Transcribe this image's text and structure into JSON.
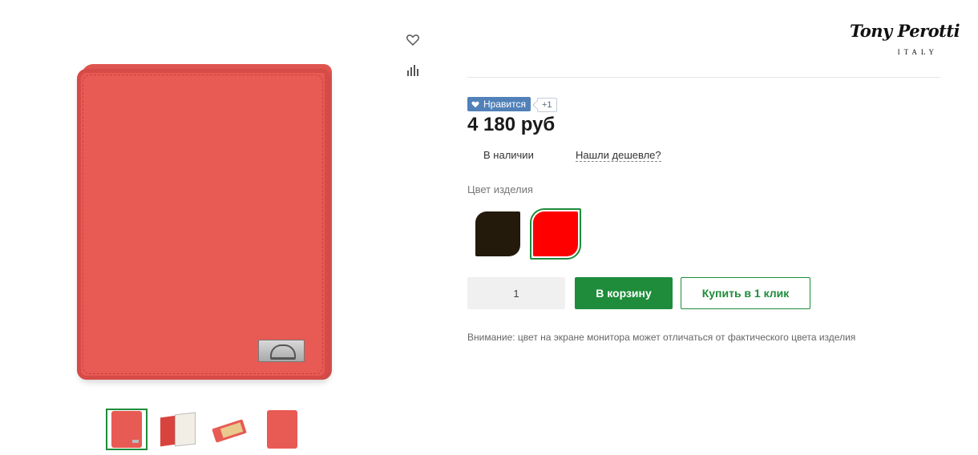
{
  "product": {
    "price": "4 180 руб",
    "stock_status": "В наличии",
    "cheaper_link": "Нашли дешевле?",
    "color_label": "Цвет изделия",
    "colors": [
      {
        "name": "dark-brown",
        "hex": "#231a0b",
        "selected": false
      },
      {
        "name": "red",
        "hex": "#ff0000",
        "selected": true
      }
    ],
    "quantity": "1",
    "notice": "Внимание: цвет на экране мониторa может отличаться от фактического цвета изделия"
  },
  "like_widget": {
    "label": "Нравится",
    "count": "+1",
    "icon": "heart-icon",
    "color": "#5181b8"
  },
  "actions": {
    "add_to_cart": "В корзину",
    "buy_one_click": "Купить в 1 клик"
  },
  "brand": {
    "logo_text": "Tony Perotti",
    "logo_subtext": "ITALY"
  },
  "gallery": {
    "thumbnails": [
      "wallet-front",
      "wallet-open",
      "wallet-open-angle",
      "wallet-back"
    ],
    "selected_index": 0
  },
  "icons": {
    "favorite": "heart-outline-icon",
    "compare": "bar-chart-icon"
  },
  "colors": {
    "accent": "#1e8c3a",
    "wallet": "#e85a54"
  }
}
